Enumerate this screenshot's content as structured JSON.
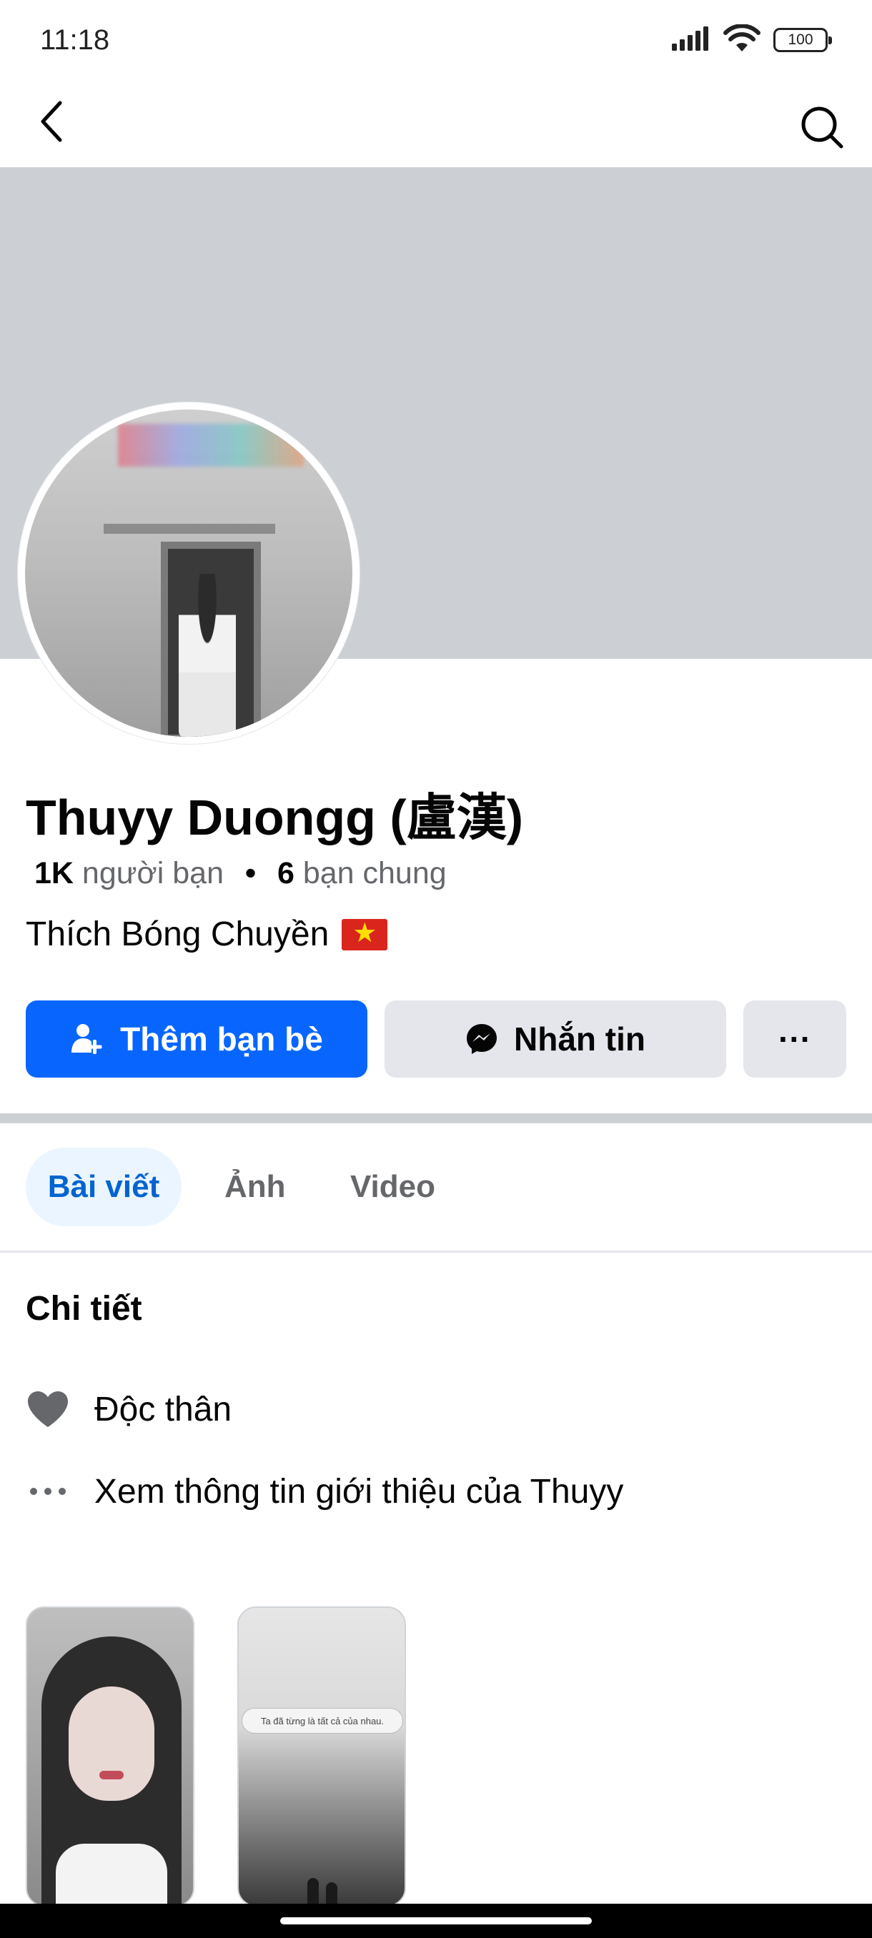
{
  "status_bar": {
    "time": "11:18",
    "battery": "100",
    "icons": [
      "signal-icon",
      "wifi-icon",
      "battery-icon"
    ]
  },
  "nav": {
    "back_icon": "chevron-left-icon",
    "search_icon": "search-icon"
  },
  "profile": {
    "name": "Thuyy Duongg (盧漢)",
    "friends_count": "1K",
    "friends_label": "người bạn",
    "separator": "•",
    "mutual_count": "6",
    "mutual_label": "bạn chung",
    "bio": "Thích Bóng Chuyền"
  },
  "actions": {
    "add_friend_label": "Thêm bạn bè",
    "message_label": "Nhắn tin",
    "more_label": "···"
  },
  "tabs": [
    {
      "label": "Bài viết",
      "active": true
    },
    {
      "label": "Ảnh",
      "active": false
    },
    {
      "label": "Video",
      "active": false
    }
  ],
  "details": {
    "title": "Chi tiết",
    "relationship": "Độc thân",
    "about_link": "Xem thông tin giới thiệu của Thuyy"
  },
  "featured": {
    "thumb2_caption": "Ta đã từng là tất cả của nhau."
  },
  "colors": {
    "primary": "#0866ff",
    "secondary_button": "#e4e6eb",
    "cover": "#ccd0d5",
    "active_tab_bg": "#ebf5ff",
    "active_tab_text": "#0064d1",
    "muted_text": "#65676b"
  }
}
